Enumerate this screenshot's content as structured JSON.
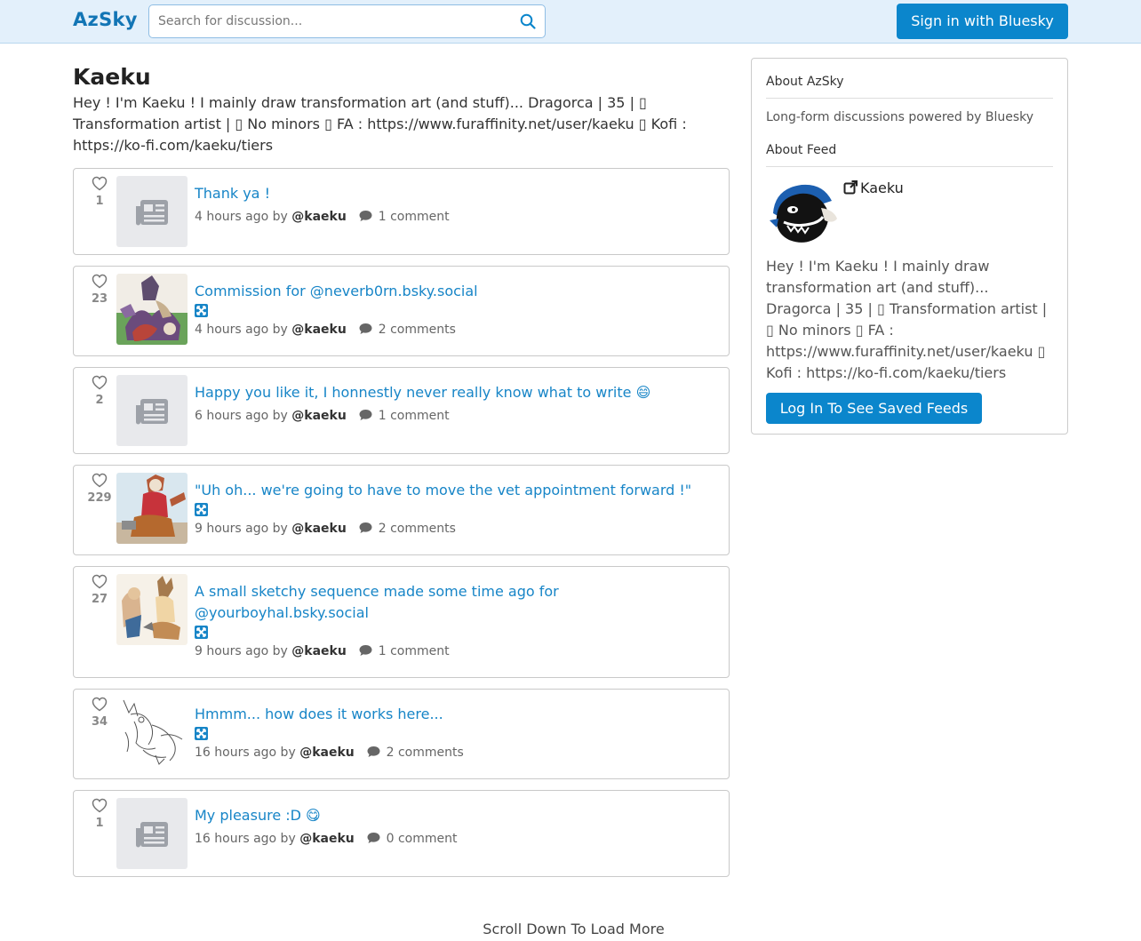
{
  "header": {
    "brand": "AzSky",
    "search_placeholder": "Search for discussion...",
    "sign_in_label": "Sign in with Bluesky"
  },
  "feed": {
    "title": "Kaeku",
    "description": "Hey ! I'm Kaeku ! I mainly draw transformation art (and stuff)... Dragorca | 35 | ▯ Transformation artist | ▯ No minors ▯ FA : https://www.furaffinity.net/user/kaeku ▯ Kofi : https://ko-fi.com/kaeku/tiers"
  },
  "posts": [
    {
      "votes": "1",
      "title": "Thank ya !",
      "time": "4 hours ago by",
      "author": "@kaeku",
      "comments": "1 comment"
    },
    {
      "votes": "23",
      "title": "Commission for @neverb0rn.bsky.social",
      "time": "4 hours ago by",
      "author": "@kaeku",
      "comments": "2 comments"
    },
    {
      "votes": "2",
      "title": "Happy you like it, I honnestly never really know what to write 😄",
      "time": "6 hours ago by",
      "author": "@kaeku",
      "comments": "1 comment"
    },
    {
      "votes": "229",
      "title": "\"Uh oh... we're going to have to move the vet appointment forward !\"",
      "time": "9 hours ago by",
      "author": "@kaeku",
      "comments": "2 comments"
    },
    {
      "votes": "27",
      "title": "A small sketchy sequence made some time ago for @yourboyhal.bsky.social",
      "time": "9 hours ago by",
      "author": "@kaeku",
      "comments": "1 comment"
    },
    {
      "votes": "34",
      "title": "Hmmm... how does it works here...",
      "time": "16 hours ago by",
      "author": "@kaeku",
      "comments": "2 comments"
    },
    {
      "votes": "1",
      "title": "My pleasure :D 😋",
      "time": "16 hours ago by",
      "author": "@kaeku",
      "comments": "0 comment"
    }
  ],
  "sidebar": {
    "about_heading": "About AzSky",
    "about_text": "Long-form discussions powered by Bluesky",
    "feed_heading": "About Feed",
    "feed_name": "Kaeku",
    "feed_desc": "Hey ! I'm Kaeku ! I mainly draw transformation art (and stuff)... Dragorca | 35 | ▯ Transformation artist | ▯ No minors ▯ FA : https://www.furaffinity.net/user/kaeku ▯ Kofi : https://ko-fi.com/kaeku/tiers",
    "login_label": "Log In To See Saved Feeds"
  },
  "footer": {
    "load_more": "Scroll Down To Load More"
  },
  "colors": {
    "accent": "#0b86cc",
    "link": "#1785c7",
    "header_bg": "#e3f0fb"
  }
}
